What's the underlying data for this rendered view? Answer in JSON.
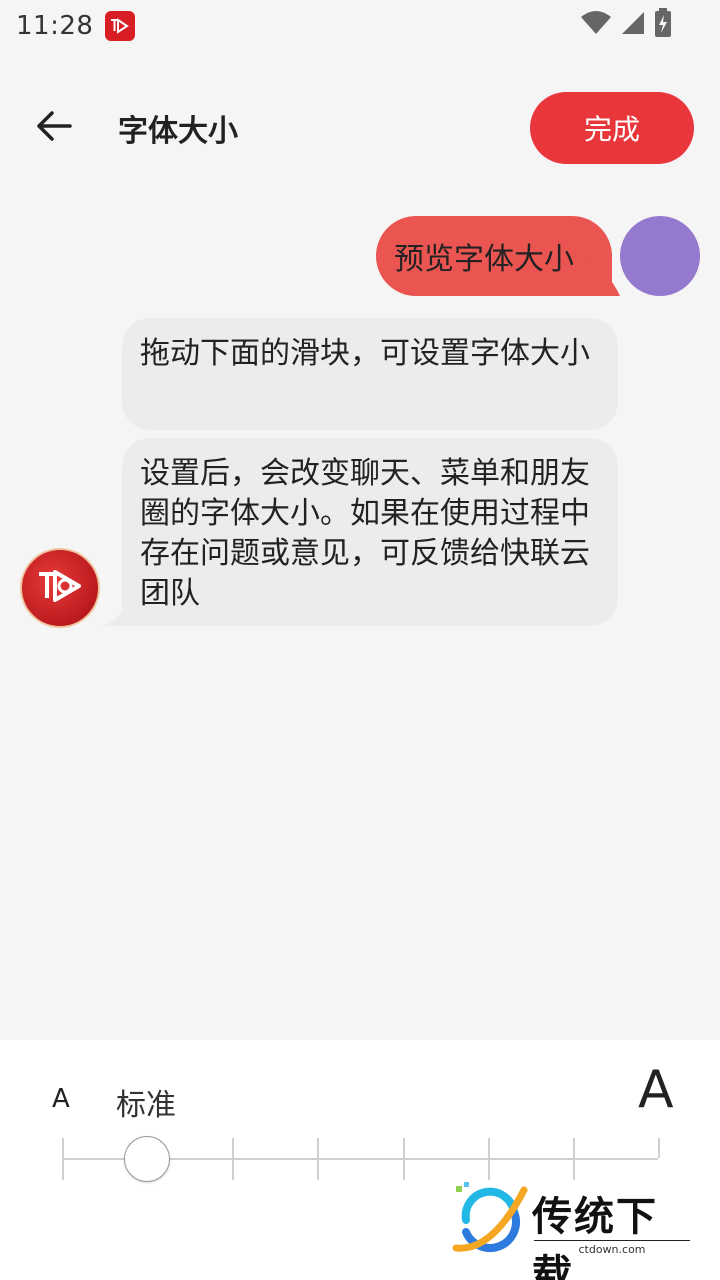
{
  "status_bar": {
    "time": "11:28"
  },
  "header": {
    "title": "字体大小",
    "done_label": "完成"
  },
  "chat": {
    "preview_text": "预览字体大小",
    "messages": [
      {
        "text": "拖动下面的滑块，可设置字体大小"
      },
      {
        "text": "设置后，会改变聊天、菜单和朋友圈的字体大小。如果在使用过程中存在问题或意见，可反馈给快联云团队"
      }
    ]
  },
  "font_size_panel": {
    "small_marker": "A",
    "current_level_label": "标准",
    "large_marker": "A",
    "slider": {
      "level_count": 8,
      "selected_level": 2
    }
  },
  "watermark": {
    "text": "传统下载",
    "url": "ctdown.com"
  },
  "colors": {
    "accent": "#e8363a",
    "preview_bubble": "#ea5551",
    "user_avatar": "#9579cf",
    "incoming_bubble": "#ececec",
    "background": "#f5f5f5"
  },
  "icons": {
    "back": "arrow-left-icon",
    "wifi": "wifi-icon",
    "signal": "cell-signal-icon",
    "battery": "battery-charging-icon",
    "app": "app-logo-icon"
  }
}
